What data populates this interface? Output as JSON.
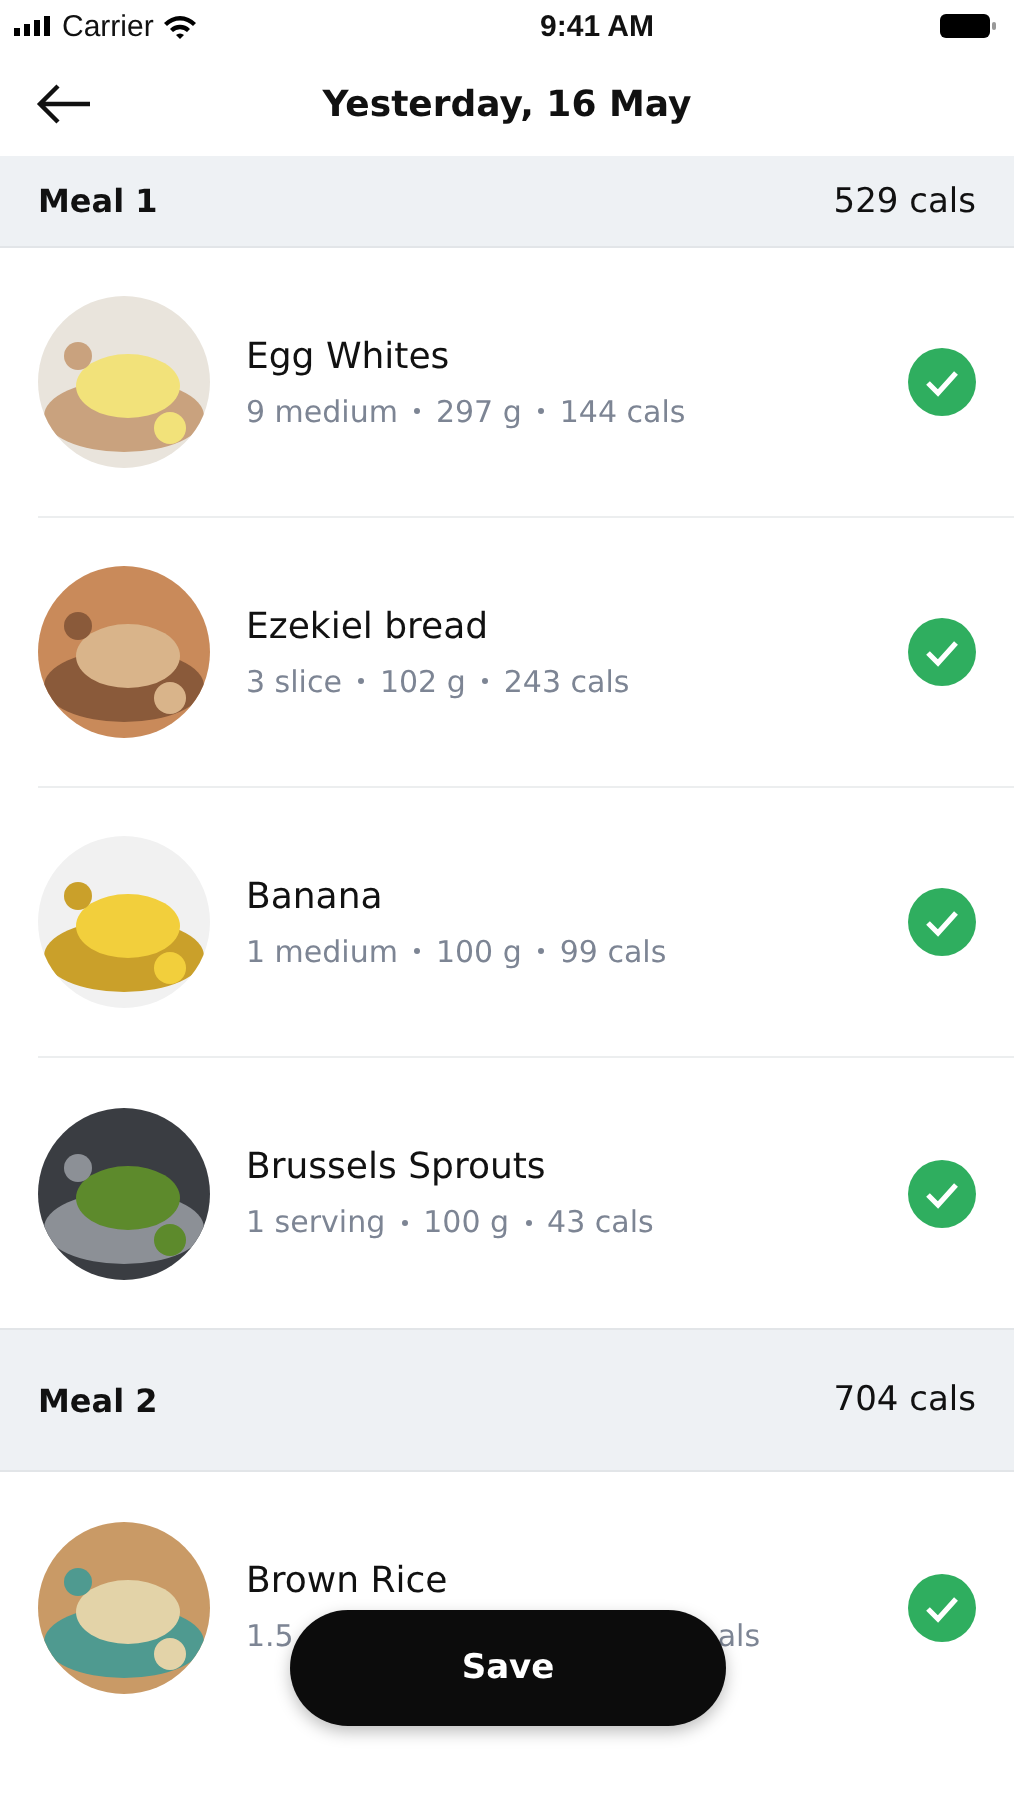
{
  "status_bar": {
    "carrier": "Carrier",
    "time": "9:41 AM"
  },
  "header": {
    "title": "Yesterday, 16 May"
  },
  "meals": [
    {
      "name": "Meal 1",
      "total": "529 cals",
      "items": [
        {
          "name": "Egg Whites",
          "details": [
            "9 medium",
            "297 g",
            "144 cals"
          ],
          "checked": true,
          "kind": "full"
        },
        {
          "name": "Ezekiel bread",
          "details": [
            "3 slice",
            "102 g",
            "243 cals"
          ],
          "checked": true,
          "kind": "full"
        },
        {
          "name": "Banana",
          "details": [
            "1 medium",
            "100 g",
            "99 cals"
          ],
          "checked": true,
          "kind": "full"
        },
        {
          "name": "Brussels Sprouts",
          "details": [
            "1 serving",
            "100 g",
            "43 cals"
          ],
          "checked": true,
          "kind": "full"
        }
      ]
    },
    {
      "name": "Meal 2",
      "total": "704 cals",
      "items": [
        {
          "name": "Brown Rice",
          "details": [
            "1.5",
            "als"
          ],
          "checked": true,
          "kind": "covered"
        }
      ]
    }
  ],
  "save_button": "Save"
}
